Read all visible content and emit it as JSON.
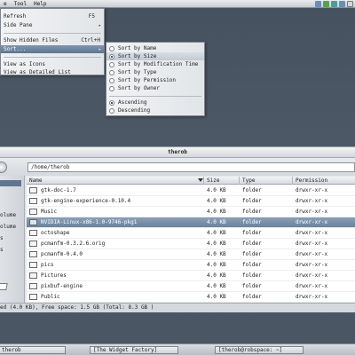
{
  "menubar": {
    "items": [
      "e",
      "Tool",
      "Help"
    ]
  },
  "view_menu": {
    "items": [
      {
        "label": "Refresh",
        "accel": "F5"
      },
      {
        "label": "Side Pane",
        "accel": ""
      },
      {
        "label": "Show Hidden Files",
        "accel": "Ctrl+H"
      },
      {
        "label": "Sort...",
        "accel": ""
      },
      {
        "label": "View as Icons",
        "accel": ""
      },
      {
        "label": "View as Detailed List",
        "accel": ""
      }
    ]
  },
  "sort_menu": {
    "items": [
      {
        "label": "Sort by Name",
        "checked": false
      },
      {
        "label": "Sort by Size",
        "checked": true
      },
      {
        "label": "Sort by Modification Time",
        "checked": false
      },
      {
        "label": "Sort by Type",
        "checked": false
      },
      {
        "label": "Sort by Permission",
        "checked": false
      },
      {
        "label": "Sort by Owner",
        "checked": false
      },
      {
        "label": "Ascending",
        "checked": true
      },
      {
        "label": "Descending",
        "checked": false
      }
    ]
  },
  "window": {
    "title": "therob",
    "path": "/home/therob"
  },
  "sidepane": {
    "labels": [
      "olume",
      "olume",
      "s",
      "s"
    ]
  },
  "columns": [
    "Name",
    "Size",
    "Type",
    "Permission"
  ],
  "files": [
    {
      "name": "gtk-doc-1.7",
      "size": "4.0 KB",
      "type": "folder",
      "perm": "drwxr-xr-x"
    },
    {
      "name": "gtk-engine-experience-0.10.4",
      "size": "4.0 KB",
      "type": "folder",
      "perm": "drwxr-xr-x"
    },
    {
      "name": "Music",
      "size": "4.0 KB",
      "type": "folder",
      "perm": "drwxr-xr-x"
    },
    {
      "name": "NVIDIA-Linux-x86-1.0-9746-pkg1",
      "size": "4.0 KB",
      "type": "folder",
      "perm": "drwxr-xr-x"
    },
    {
      "name": "octoshape",
      "size": "4.0 KB",
      "type": "folder",
      "perm": "drwxr-xr-x"
    },
    {
      "name": "pcmanfm-0.3.2.6.orig",
      "size": "4.0 KB",
      "type": "folder",
      "perm": "drwxr-xr-x"
    },
    {
      "name": "pcmanfm-0.4.0",
      "size": "4.0 KB",
      "type": "folder",
      "perm": "drwxr-xr-x"
    },
    {
      "name": "pics",
      "size": "4.0 KB",
      "type": "folder",
      "perm": "drwxr-xr-x"
    },
    {
      "name": "Pictures",
      "size": "4.0 KB",
      "type": "folder",
      "perm": "drwxr-xr-x"
    },
    {
      "name": "pixbuf-engine",
      "size": "4.0 KB",
      "type": "folder",
      "perm": "drwxr-xr-x"
    },
    {
      "name": "Public",
      "size": "4.0 KB",
      "type": "folder",
      "perm": "drwxr-xr-x"
    }
  ],
  "status_text": "ed (4.0 KB), Free space: 1.5 GB (Total: 8.3 GB )",
  "taskbar": {
    "items": [
      "therob",
      "[The Widget Factory]",
      "[therob@robspace: ~]"
    ]
  },
  "colors": {
    "highlight": "#6b829d",
    "tray": [
      "#6a8fb3",
      "#5aa04a",
      "#4f9a9a",
      "#6a8fb3",
      "#d3d6da"
    ]
  }
}
